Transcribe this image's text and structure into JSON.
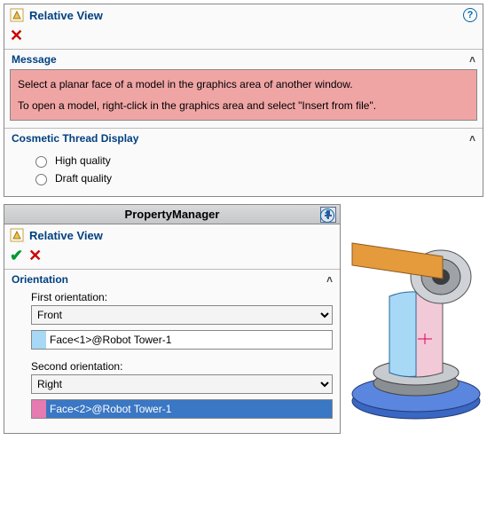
{
  "top_panel": {
    "title": "Relative View",
    "message_header": "Message",
    "message_p1": "Select a planar face of a model in the graphics area of another window.",
    "message_p2": "To open a model, right-click in the graphics area and select \"Insert from file\".",
    "thread_header": "Cosmetic Thread Display",
    "radio_hq": "High quality",
    "radio_dq": "Draft quality"
  },
  "bottom_panel": {
    "pm_title": "PropertyManager",
    "title": "Relative View",
    "orientation_header": "Orientation",
    "first_label": "First orientation:",
    "first_value": "Front",
    "first_face": "Face<1>@Robot Tower-1",
    "second_label": "Second orientation:",
    "second_value": "Right",
    "second_face": "Face<2>@Robot Tower-1"
  },
  "colors": {
    "swatch1": "#a7d8f5",
    "swatch2": "#e77ab0"
  }
}
